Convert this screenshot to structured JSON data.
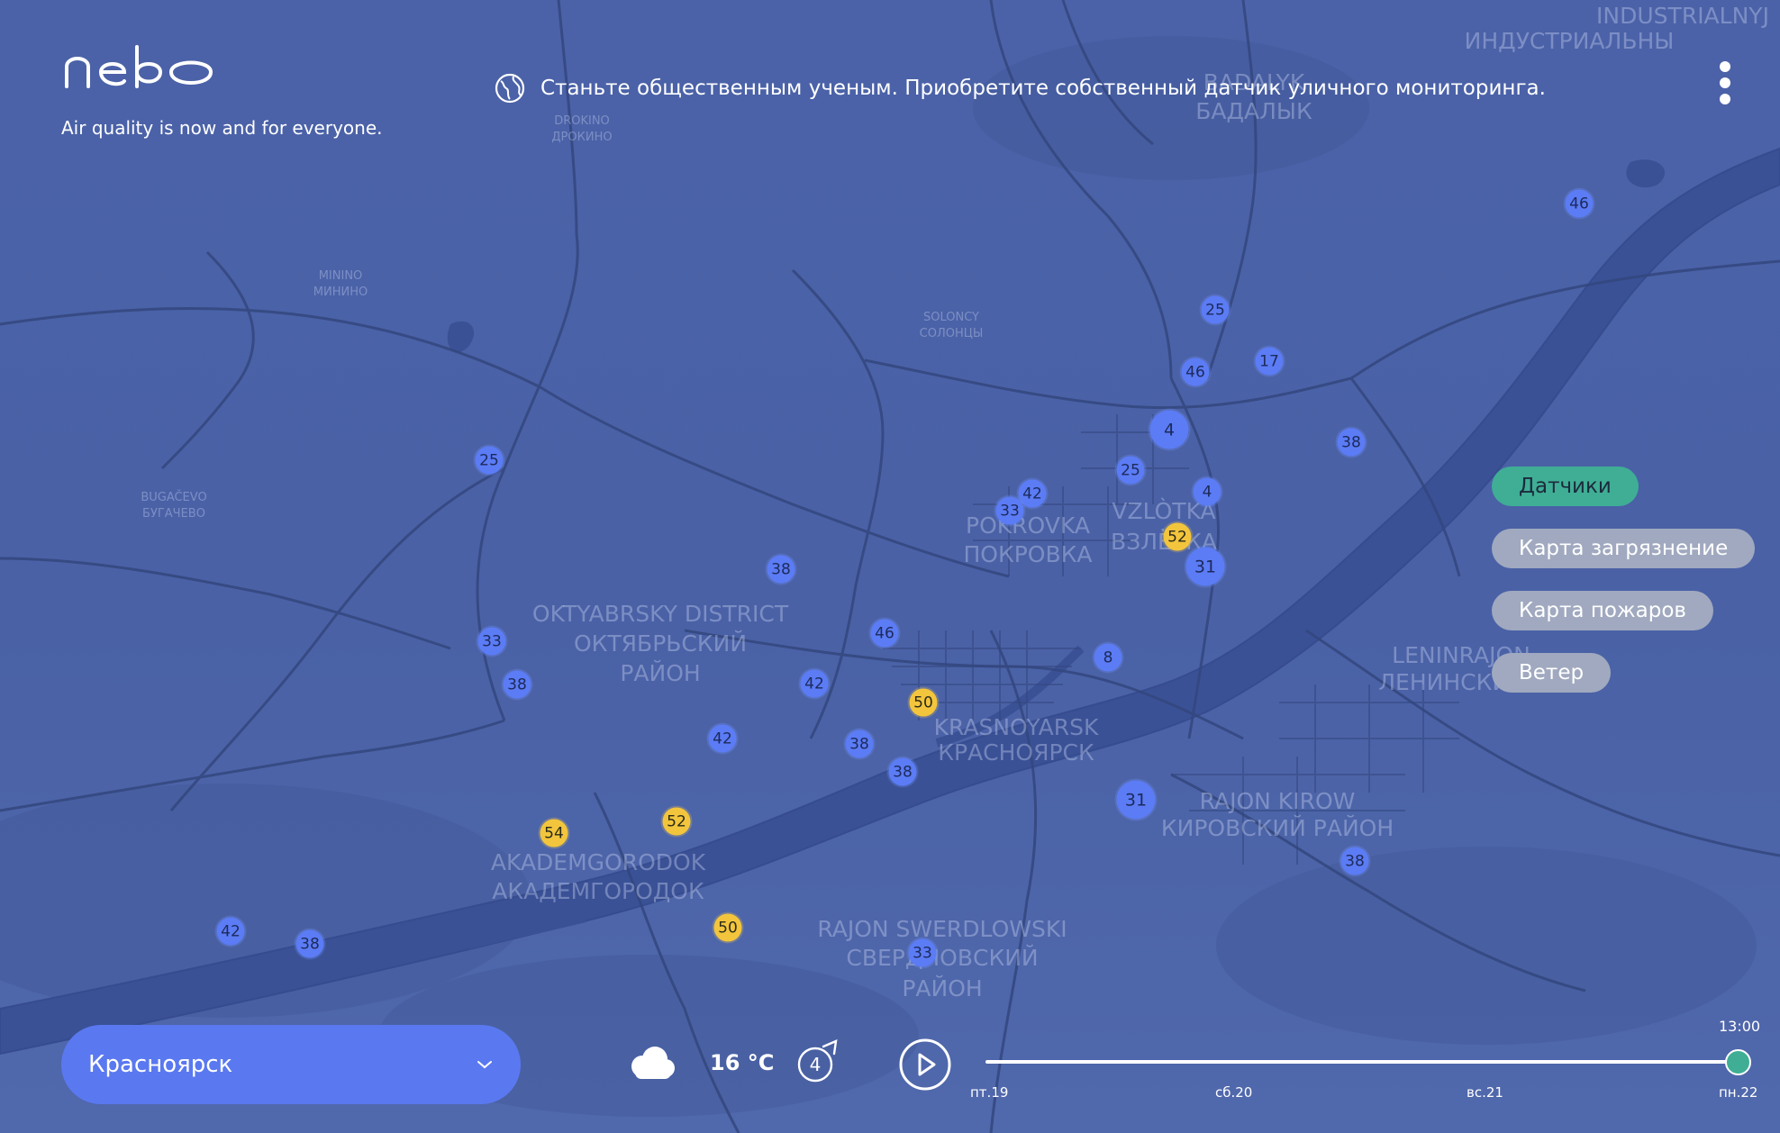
{
  "brand": {
    "logo_text": "nebo",
    "tagline": "Air quality is now and for everyone."
  },
  "promo": {
    "text": "Станьте общественным ученым. Приобретите собственный датчик уличного мониторинга.",
    "icon": "globe-icon"
  },
  "menu": {
    "icon": "kebab-menu-icon"
  },
  "layers": [
    {
      "label": "Датчики",
      "active": true
    },
    {
      "label": "Карта загрязнение",
      "active": false
    },
    {
      "label": "Карта пожаров",
      "active": false
    },
    {
      "label": "Ветер",
      "active": false
    }
  ],
  "city_select": {
    "value": "Красноярск",
    "icon": "chevron-down-icon"
  },
  "weather": {
    "icon": "cloud-icon",
    "temperature": "16 °C",
    "wind_speed": "4",
    "wind_icon": "wind-direction-icon"
  },
  "timeline": {
    "play_icon": "play-icon",
    "current_time": "13:00",
    "days": [
      "пт.19",
      "сб.20",
      "вс.21",
      "пн.22"
    ],
    "position_fraction": 1.0
  },
  "colors": {
    "map_bg": "#4a61a6",
    "sensor_blue": "#5b7cf5",
    "sensor_yellow": "#f2c53c",
    "accent_green": "#3fae95",
    "select_blue": "#5a79f0"
  },
  "map_labels": [
    "INDUSTRIALNYJ",
    "ИНДУСТРИАЛЬНЫ",
    "BADALYK",
    "БАДАЛЫК",
    "DROKINO",
    "ДРОКИНО",
    "MININO",
    "МИНИНО",
    "SOLONCY",
    "СОЛОНЦЫ",
    "BUGAČEVO",
    "БУГАЧЕВО",
    "POKROVKA",
    "ПОКРОВКА",
    "VZLÒTKA",
    "ВЗЛЁТКА",
    "OKTYABRSKY DISTRICT",
    "ОКТЯБРЬСКИЙ",
    "РАЙОН",
    "LENINRAJON",
    "ЛЕНИНСКИЙ",
    "KRASNOYARSK",
    "КРАСНОЯРСК",
    "RAJON KIROW",
    "КИРОВСКИЙ РАЙОН",
    "AKADEMGORODOK",
    "АКАДЕМГОРОДОК",
    "RAJON SWERDLOWSKI",
    "СВЕРДЛОВСКИЙ",
    "РАЙОН"
  ],
  "sensors": [
    {
      "value": "46",
      "color": "blue"
    },
    {
      "value": "25",
      "color": "blue"
    },
    {
      "value": "17",
      "color": "blue"
    },
    {
      "value": "46",
      "color": "blue"
    },
    {
      "value": "4",
      "color": "blue"
    },
    {
      "value": "38",
      "color": "blue"
    },
    {
      "value": "25",
      "color": "blue"
    },
    {
      "value": "42",
      "color": "blue"
    },
    {
      "value": "33",
      "color": "blue"
    },
    {
      "value": "4",
      "color": "blue"
    },
    {
      "value": "52",
      "color": "yellow"
    },
    {
      "value": "31",
      "color": "blue"
    },
    {
      "value": "25",
      "color": "blue"
    },
    {
      "value": "38",
      "color": "blue"
    },
    {
      "value": "33",
      "color": "blue"
    },
    {
      "value": "38",
      "color": "blue"
    },
    {
      "value": "46",
      "color": "blue"
    },
    {
      "value": "42",
      "color": "blue"
    },
    {
      "value": "50",
      "color": "yellow"
    },
    {
      "value": "8",
      "color": "blue"
    },
    {
      "value": "42",
      "color": "blue"
    },
    {
      "value": "38",
      "color": "blue"
    },
    {
      "value": "38",
      "color": "blue"
    },
    {
      "value": "31",
      "color": "blue"
    },
    {
      "value": "54",
      "color": "yellow"
    },
    {
      "value": "52",
      "color": "yellow"
    },
    {
      "value": "38",
      "color": "blue"
    },
    {
      "value": "50",
      "color": "yellow"
    },
    {
      "value": "33",
      "color": "blue"
    },
    {
      "value": "42",
      "color": "blue"
    },
    {
      "value": "38",
      "color": "blue"
    }
  ]
}
